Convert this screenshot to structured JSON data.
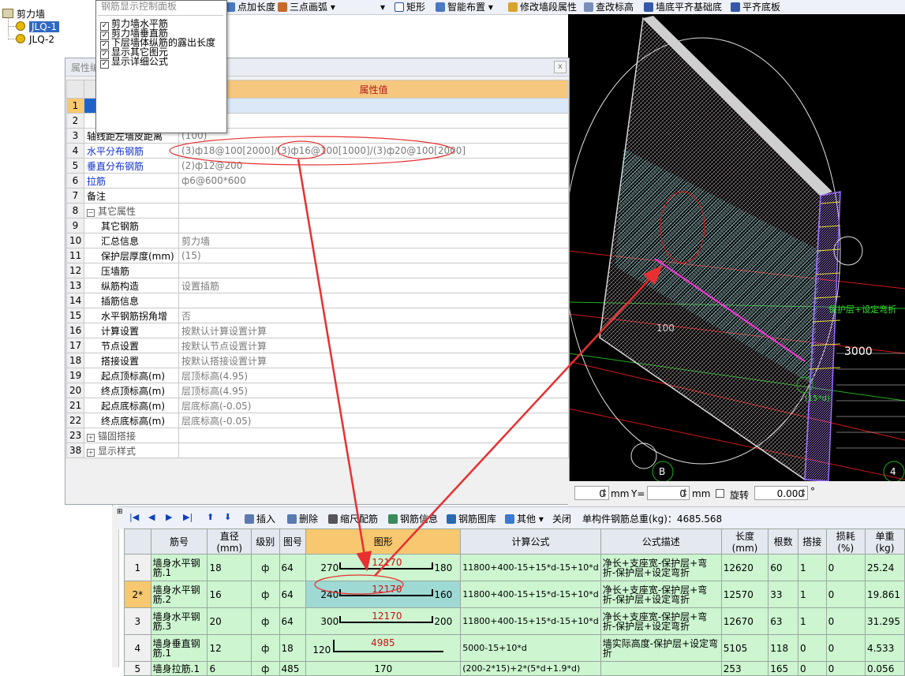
{
  "tree": {
    "root": "剪力墙",
    "items": [
      "JLQ-1",
      "JLQ-2"
    ]
  },
  "toolbar": {
    "items": [
      "点加长度",
      "三点画弧",
      "矩形",
      "智能布置",
      "修改墙段属性",
      "查改标高",
      "墙底平齐基础底",
      "平齐底板"
    ],
    "arrow_label": "▾"
  },
  "panel": {
    "title": "钢筋显示控制面板",
    "options": [
      {
        "label": "剪力墙水平筋",
        "checked": true
      },
      {
        "label": "剪力墙垂直筋",
        "checked": true
      },
      {
        "label": "下层墙体纵筋的露出长度",
        "checked": true
      },
      {
        "label": "显示其它图元",
        "checked": true
      },
      {
        "label": "显示详细公式",
        "checked": true
      }
    ]
  },
  "properties": {
    "title": "属性编辑",
    "header_value": "属性值",
    "close": "x",
    "rows": [
      {
        "n": "1",
        "name": "",
        "value": ""
      },
      {
        "n": "2",
        "name": "",
        "value": ""
      },
      {
        "n": "3",
        "name": "轴线距左墙皮距离",
        "value": "(100)"
      },
      {
        "n": "4",
        "name": "水平分布钢筋",
        "value": "(3)ф18@100[2000]/(3)ф16@100[1000]/(3)ф20@100[2000]"
      },
      {
        "n": "5",
        "name": "垂直分布钢筋",
        "value": "(2)ф12@200"
      },
      {
        "n": "6",
        "name": "拉筋",
        "value": "ф6@600*600"
      },
      {
        "n": "7",
        "name": "备注",
        "value": ""
      },
      {
        "n": "8",
        "name": "其它属性",
        "value": ""
      },
      {
        "n": "9",
        "name": "其它钢筋",
        "value": ""
      },
      {
        "n": "10",
        "name": "汇总信息",
        "value": "剪力墙"
      },
      {
        "n": "11",
        "name": "保护层厚度(mm)",
        "value": "(15)"
      },
      {
        "n": "12",
        "name": "压墙筋",
        "value": ""
      },
      {
        "n": "13",
        "name": "纵筋构造",
        "value": "设置插筋"
      },
      {
        "n": "14",
        "name": "插筋信息",
        "value": ""
      },
      {
        "n": "15",
        "name": "水平钢筋拐角增",
        "value": "否"
      },
      {
        "n": "16",
        "name": "计算设置",
        "value": "按默认计算设置计算"
      },
      {
        "n": "17",
        "name": "节点设置",
        "value": "按默认节点设置计算"
      },
      {
        "n": "18",
        "name": "搭接设置",
        "value": "按默认搭接设置计算"
      },
      {
        "n": "19",
        "name": "起点顶标高(m)",
        "value": "层顶标高(4.95)"
      },
      {
        "n": "20",
        "name": "终点顶标高(m)",
        "value": "层顶标高(4.95)"
      },
      {
        "n": "21",
        "name": "起点底标高(m)",
        "value": "层底标高(-0.05)"
      },
      {
        "n": "22",
        "name": "终点底标高(m)",
        "value": "层底标高(-0.05)"
      },
      {
        "n": "23",
        "name": "锚固搭接",
        "value": ""
      },
      {
        "n": "38",
        "name": "显示样式",
        "value": ""
      }
    ]
  },
  "cad": {
    "dim_3000": "3000",
    "dim_100": "100",
    "label_b": "B",
    "label_4": "4",
    "note_green": "保护层+设定弯折",
    "note_15d": "(15*d)"
  },
  "coord": {
    "x_value": "0",
    "x_unit": "mm",
    "y_label": "Y=",
    "y_value": "0",
    "y_unit": "mm",
    "rotate_label": "旋转",
    "rotate_value": "0.000",
    "degree": "°"
  },
  "bottom_toolbar": {
    "insert": "插入",
    "delete": "删除",
    "scale_rebar": "缩尺配筋",
    "rebar_info": "钢筋信息",
    "rebar_lib": "钢筋图库",
    "other": "其他",
    "close": "关闭",
    "total_weight": "单构件钢筋总重(kg)：4685.568"
  },
  "rebar_table": {
    "headers": [
      "",
      "筋号",
      "直径(mm)",
      "级别",
      "图号",
      "图形",
      "计算公式",
      "公式描述",
      "长度(mm)",
      "根数",
      "搭接",
      "损耗(%)",
      "单重(kg)"
    ],
    "rows": [
      {
        "n": "1",
        "name": "墙身水平钢筋.1",
        "dia": "18",
        "grade": "ф",
        "fig": "64",
        "left": "270",
        "mid": "12170",
        "right": "180",
        "formula": "11800+400-15+15*d-15+10*d",
        "desc": "净长+支座宽-保护层+弯折-保护层+设定弯折",
        "len": "12620",
        "count": "60",
        "lap": "1",
        "loss": "0",
        "unit": "25.24"
      },
      {
        "n": "2*",
        "name": "墙身水平钢筋.2",
        "dia": "16",
        "grade": "ф",
        "fig": "64",
        "left": "240",
        "mid": "12170",
        "right": "160",
        "formula": "11800+400-15+15*d-15+10*d",
        "desc": "净长+支座宽-保护层+弯折-保护层+设定弯折",
        "len": "12570",
        "count": "33",
        "lap": "1",
        "loss": "0",
        "unit": "19.861"
      },
      {
        "n": "3",
        "name": "墙身水平钢筋.3",
        "dia": "20",
        "grade": "ф",
        "fig": "64",
        "left": "300",
        "mid": "12170",
        "right": "200",
        "formula": "11800+400-15+15*d-15+10*d",
        "desc": "净长+支座宽-保护层+弯折-保护层+设定弯折",
        "len": "12670",
        "count": "63",
        "lap": "1",
        "loss": "0",
        "unit": "31.295"
      },
      {
        "n": "4",
        "name": "墙身垂直钢筋.1",
        "dia": "12",
        "grade": "ф",
        "fig": "18",
        "left": "120",
        "mid": "4985",
        "right": "",
        "formula": "5000-15+10*d",
        "desc": "墙实际高度-保护层+设定弯折",
        "len": "5105",
        "count": "118",
        "lap": "0",
        "loss": "0",
        "unit": "4.533"
      },
      {
        "n": "5",
        "name": "墙身拉筋.1",
        "dia": "6",
        "grade": "ф",
        "fig": "485",
        "left": "",
        "mid": "170",
        "right": "",
        "formula": "(200-2*15)+2*(5*d+1.9*d)",
        "desc": "",
        "len": "253",
        "count": "165",
        "lap": "0",
        "loss": "0",
        "unit": "0.056"
      }
    ]
  }
}
